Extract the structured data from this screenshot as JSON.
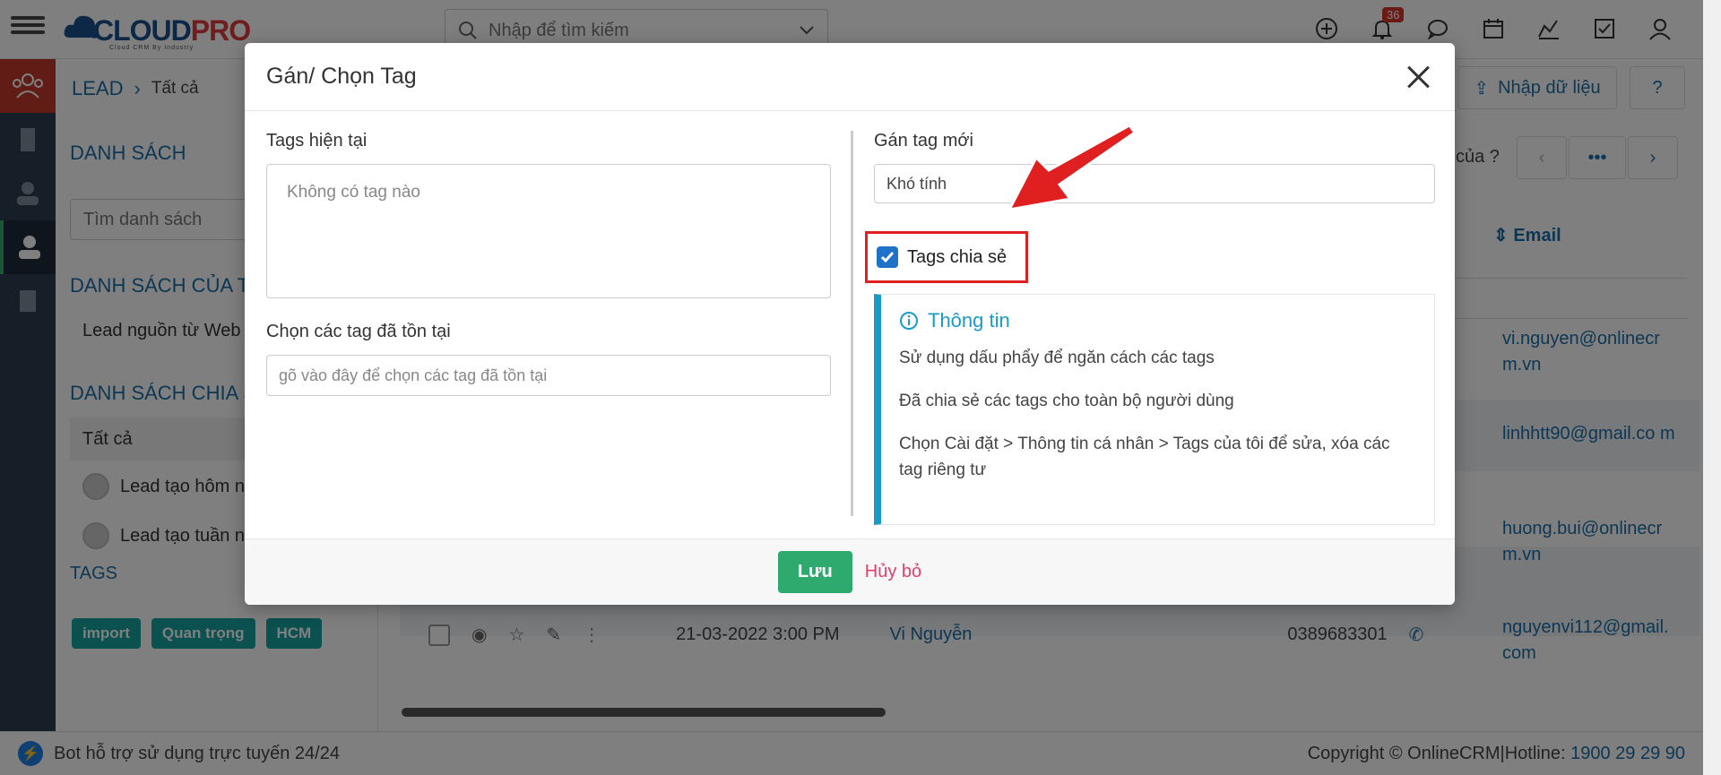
{
  "header": {
    "logo_text_1": "CLOUD",
    "logo_text_2": "PRO",
    "logo_sub": "Cloud CRM By Industry",
    "search_placeholder": "Nhập để tìm kiếm",
    "notif_count": "36"
  },
  "breadcrumb": {
    "module": "LEAD",
    "current": "Tất cả"
  },
  "sidebar": {
    "section_list": "DANH SÁCH",
    "search_placeholder": "Tìm danh sách",
    "section_mine": "DANH SÁCH CỦA TÔ",
    "mine_items": [
      "Lead nguồn từ Web"
    ],
    "section_shared": "DANH SÁCH CHIA S",
    "shared_items": [
      "Tất cả",
      "Lead tạo hôm n",
      "Lead tạo tuần n"
    ],
    "section_tags": "TAGS",
    "tags": [
      "import",
      "Quan trọng",
      "HCM"
    ]
  },
  "main": {
    "import_label": "Nhập dữ liệu",
    "pager_text": "của ?",
    "email_header": "Email",
    "emails": [
      "vi.nguyen@onlinecr m.vn",
      "linhhtt90@gmail.co m",
      "huong.bui@onlinecr m.vn",
      "nguyenvi112@gmail. com"
    ],
    "row": {
      "date": "21-03-2022 3:00 PM",
      "name": "Vi Nguyễn",
      "phone": "0389683301"
    }
  },
  "footer": {
    "bot_text": "Bot hỗ trợ sử dụng trực tuyến 24/24",
    "copyright": "Copyright © OnlineCRM|Hotline: ",
    "hotline": "1900 29 29 90"
  },
  "modal": {
    "title": "Gán/ Chọn Tag",
    "current_tags_label": "Tags hiện tại",
    "no_tags": "Không có tag nào",
    "choose_label": "Chọn các tag đã tồn tại",
    "choose_placeholder": "gõ vào đây để chọn các tag đã tồn tại",
    "new_tag_label": "Gán tag mới",
    "new_tag_value": "Khó tính",
    "shared_checkbox_label": "Tags chia sẻ",
    "shared_checked": true,
    "info_title": "Thông tin",
    "info_lines": [
      "Sử dụng dấu phẩy để ngăn cách các tags",
      "Đã chia sẻ các tags cho toàn bộ người dùng",
      "Chọn Cài đặt > Thông tin cá nhân > Tags của tôi để sửa, xóa các tag riêng tư"
    ],
    "save_label": "Lưu",
    "cancel_label": "Hủy bỏ"
  },
  "colors": {
    "accent": "#1a6fa8",
    "save": "#2eaa6e",
    "highlight": "#e02020",
    "info": "#1a9bc7"
  }
}
